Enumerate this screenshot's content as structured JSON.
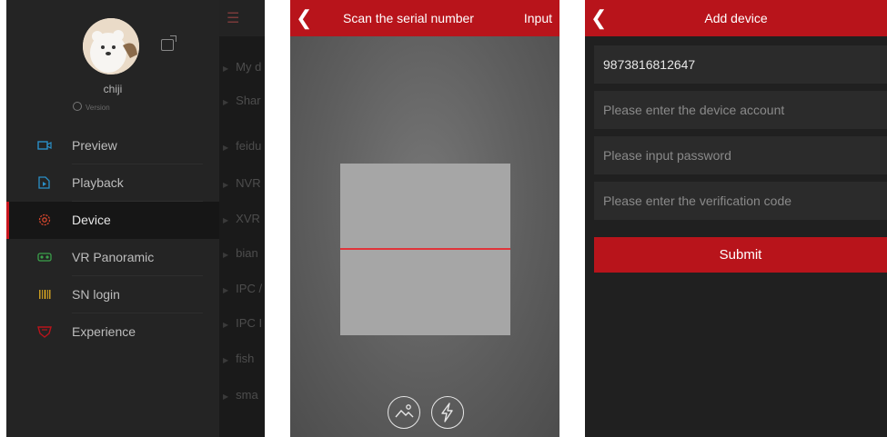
{
  "sidebar": {
    "username": "chiji",
    "version": "Version",
    "items": [
      {
        "label": "Preview",
        "icon": "camera-icon"
      },
      {
        "label": "Playback",
        "icon": "playback-icon"
      },
      {
        "label": "Device",
        "icon": "device-gear-icon",
        "active": true
      },
      {
        "label": "VR Panoramic",
        "icon": "vr-icon"
      },
      {
        "label": "SN login",
        "icon": "barcode-icon"
      },
      {
        "label": "Experience",
        "icon": "experience-icon"
      }
    ],
    "behind_list": [
      "My d",
      "Shar",
      "feidu",
      "NVR",
      "XVR",
      "bian",
      "IPC /",
      "IPC I",
      "fish",
      "sma"
    ]
  },
  "scan": {
    "title": "Scan the serial number",
    "input_label": "Input"
  },
  "add_device": {
    "title": "Add device",
    "serial_value": "9873816812647",
    "account_placeholder": "Please enter the device account",
    "password_placeholder": "Please input password",
    "code_placeholder": "Please enter the verification code",
    "submit_label": "Submit"
  },
  "colors": {
    "accent": "#b8141b",
    "dark_bg": "#202020",
    "scanline": "#e0343a"
  }
}
